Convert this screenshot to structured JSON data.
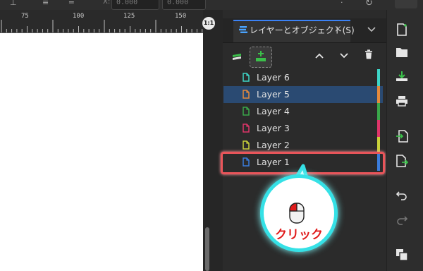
{
  "toolbar": {
    "x_label": "X:",
    "x_value": "0.000",
    "y_value": "0.000"
  },
  "ruler": {
    "labels": [
      "75",
      "100",
      "125",
      "150"
    ]
  },
  "snap_button": {
    "label": "1:1"
  },
  "panel": {
    "tab_label": "レイヤーとオブジェクト(S)",
    "tab_close": "×",
    "tab_more": "⌄"
  },
  "layers": [
    {
      "name": "Layer 6",
      "color": "#3ed6c8",
      "selected": false
    },
    {
      "name": "Layer 5",
      "color": "#e58a3c",
      "selected": true
    },
    {
      "name": "Layer 4",
      "color": "#3aa84a",
      "selected": false
    },
    {
      "name": "Layer 3",
      "color": "#e0356a",
      "selected": false
    },
    {
      "name": "Layer 2",
      "color": "#c9d23a",
      "selected": false
    },
    {
      "name": "Layer 1",
      "color": "#3b7ddd",
      "selected": false
    }
  ],
  "callout": {
    "text": "クリック",
    "border_color": "#35e1e6",
    "text_color": "#e01b1b"
  },
  "colors": {
    "selected_row": "#2a4a72",
    "highlight": "#e9555a",
    "accent": "#3b82f6"
  },
  "icons": {
    "tool_layers": "layers-icon",
    "tool_add": "add-layer-icon",
    "tool_up": "chevron-up-icon",
    "tool_down": "chevron-down-icon",
    "tool_delete": "trash-icon"
  }
}
